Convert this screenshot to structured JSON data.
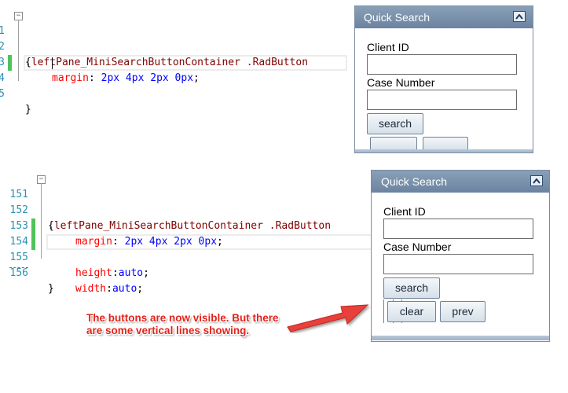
{
  "top_code": {
    "lines": [
      {
        "num": "1",
        "fold": "−",
        "selector": ".leftPane_MiniSearchButtonContainer .RadButton",
        "text": ""
      },
      {
        "num": "2",
        "text": "{"
      },
      {
        "num": "3",
        "prop": "margin",
        "val": "2px 4px 2px 0px"
      },
      {
        "num": "4",
        "text": "",
        "changed": true,
        "cursor": true
      },
      {
        "num": "5",
        "text": "}"
      }
    ]
  },
  "bottom_code": {
    "lines": [
      {
        "num": "151",
        "fold": "−",
        "selector": ".leftPane_MiniSearchButtonContainer .RadButton"
      },
      {
        "num": "152",
        "text": "{"
      },
      {
        "num": "153",
        "prop": "margin",
        "val": "2px 4px 2px 0px"
      },
      {
        "num": "154",
        "prop": "height",
        "val": "auto",
        "changed": true
      },
      {
        "num": "155",
        "prop": "width",
        "val": "auto",
        "changed": true
      },
      {
        "num": "156",
        "text": "}"
      }
    ]
  },
  "panel_top": {
    "title": "Quick Search",
    "client_id_label": "Client ID",
    "client_id_value": "",
    "case_number_label": "Case Number",
    "case_number_value": "",
    "search_label": "search"
  },
  "panel_bottom": {
    "title": "Quick Search",
    "client_id_label": "Client ID",
    "client_id_value": "",
    "case_number_label": "Case Number",
    "case_number_value": "",
    "search_label": "search",
    "clear_label": "clear",
    "prev_label": "prev"
  },
  "annotation": {
    "text": "The buttons are now visible. But there are some vertical lines showing.",
    "color": "#e3231b"
  }
}
